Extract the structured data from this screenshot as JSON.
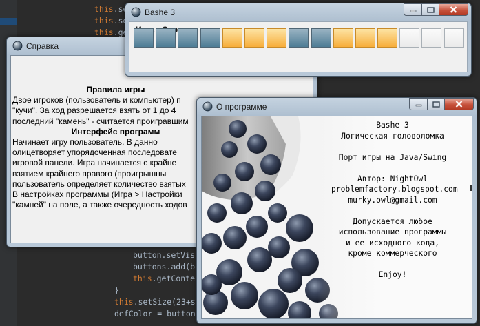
{
  "editor": {
    "lines": [
      {
        "kw": "this",
        "rest": ".se"
      },
      {
        "kw": "this",
        "rest": ".se"
      },
      {
        "kw": "this",
        "rest": ".ge"
      },
      {
        "kw": "",
        "rest": "button.setVis"
      },
      {
        "kw": "",
        "rest": "buttons.add(b"
      },
      {
        "kw": "this",
        "rest": ".getConte"
      },
      {
        "kw": "",
        "rest": "}"
      },
      {
        "kw": "this",
        "rest": ".setSize(23+s"
      },
      {
        "kw": "",
        "rest": "defColor = button"
      }
    ]
  },
  "help_window": {
    "title": "Справка",
    "lines": [
      {
        "text": "Правила игры",
        "heading": true
      },
      {
        "text": "Двое игроков (пользователь и компьютер) п",
        "heading": false
      },
      {
        "text": "\"кучи\". За ход разрешается взять от 1 до 4",
        "heading": false
      },
      {
        "text": "последний \"камень\" - считается проигравшим",
        "heading": false
      },
      {
        "text": "Интерфейс программ",
        "heading": true
      },
      {
        "text": "Начинает игру пользователь. В данно",
        "heading": false
      },
      {
        "text": "олицетворяет упорядоченная последовате",
        "heading": false
      },
      {
        "text": "игровой панели. Игра начинается с крайне",
        "heading": false
      },
      {
        "text": "взятием крайнего правого (проигрышны",
        "heading": false
      },
      {
        "text": "пользователь определяет количество взятых",
        "heading": false
      },
      {
        "text": "В настройках программы (Игра > Настройки",
        "heading": false
      },
      {
        "text": "\"камней\" на поле, а также очередность ходов",
        "heading": false
      }
    ]
  },
  "game_window": {
    "title": "Bashe 3",
    "menu": [
      "Игра",
      "Справка"
    ],
    "stones": [
      "blue",
      "blue",
      "blue",
      "blue",
      "orange",
      "orange",
      "orange",
      "blue",
      "blue",
      "orange",
      "orange",
      "orange",
      "white",
      "white",
      "white"
    ]
  },
  "about_window": {
    "title": "О программе",
    "lines": [
      "Bashe 3",
      "Логическая головоломка",
      "",
      "Порт игры на Java/Swing",
      "",
      "Автор: NightOwl",
      "problemfactory.blogspot.com",
      "murky.owl@gmail.com",
      "",
      "Допускается любое",
      "использование программы",
      "и ее исходного кода,",
      "кроме коммерческого",
      "",
      "Enjoy!"
    ]
  },
  "icons": {
    "app": "bashe-app-icon",
    "minimize": "minimize-icon",
    "maximize": "maximize-icon",
    "close": "close-icon"
  },
  "colors": {
    "stone_blue": "#6f96ab",
    "stone_orange": "#f9c560",
    "stone_white": "#f4f4f4",
    "close_red": "#c7523c",
    "editor_bg": "#2b2b2b"
  }
}
